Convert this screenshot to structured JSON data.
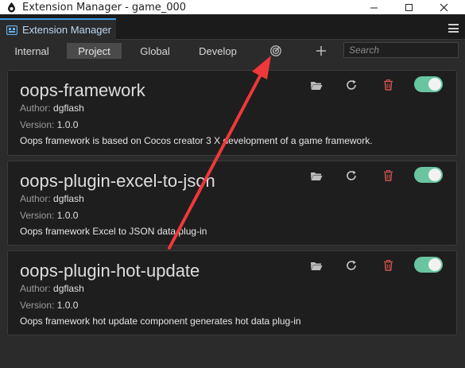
{
  "window": {
    "title": "Extension Manager - game_000"
  },
  "panel": {
    "tab_label": "Extension Manager"
  },
  "toolbar": {
    "tabs": [
      {
        "label": "Internal",
        "active": false
      },
      {
        "label": "Project",
        "active": true
      },
      {
        "label": "Global",
        "active": false
      },
      {
        "label": "Develop",
        "active": false
      }
    ],
    "search_placeholder": "Search"
  },
  "labels": {
    "author": "Author:",
    "version": "Version:"
  },
  "extensions": [
    {
      "name": "oops-framework",
      "author": "dgflash",
      "version": "1.0.0",
      "description": "Oops framework is based on Cocos creator 3 X development of a game framework.",
      "enabled": true
    },
    {
      "name": "oops-plugin-excel-to-json",
      "author": "dgflash",
      "version": "1.0.0",
      "description": "Oops framework Excel to JSON data plug-in",
      "enabled": true
    },
    {
      "name": "oops-plugin-hot-update",
      "author": "dgflash",
      "version": "1.0.0",
      "description": "Oops framework hot update component generates hot data plug-in",
      "enabled": true
    }
  ],
  "colors": {
    "toggle_on": "#69c5a0",
    "delete_icon": "#d9534f",
    "annotation_arrow": "#f0383a",
    "accent": "#3d9be9"
  },
  "icons": {
    "app": "cocos-logo-icon",
    "panel": "extension-icon",
    "radar": "radar-scan-icon",
    "add": "plus-icon",
    "open": "folder-open-icon",
    "refresh": "refresh-icon",
    "delete": "trash-icon"
  }
}
